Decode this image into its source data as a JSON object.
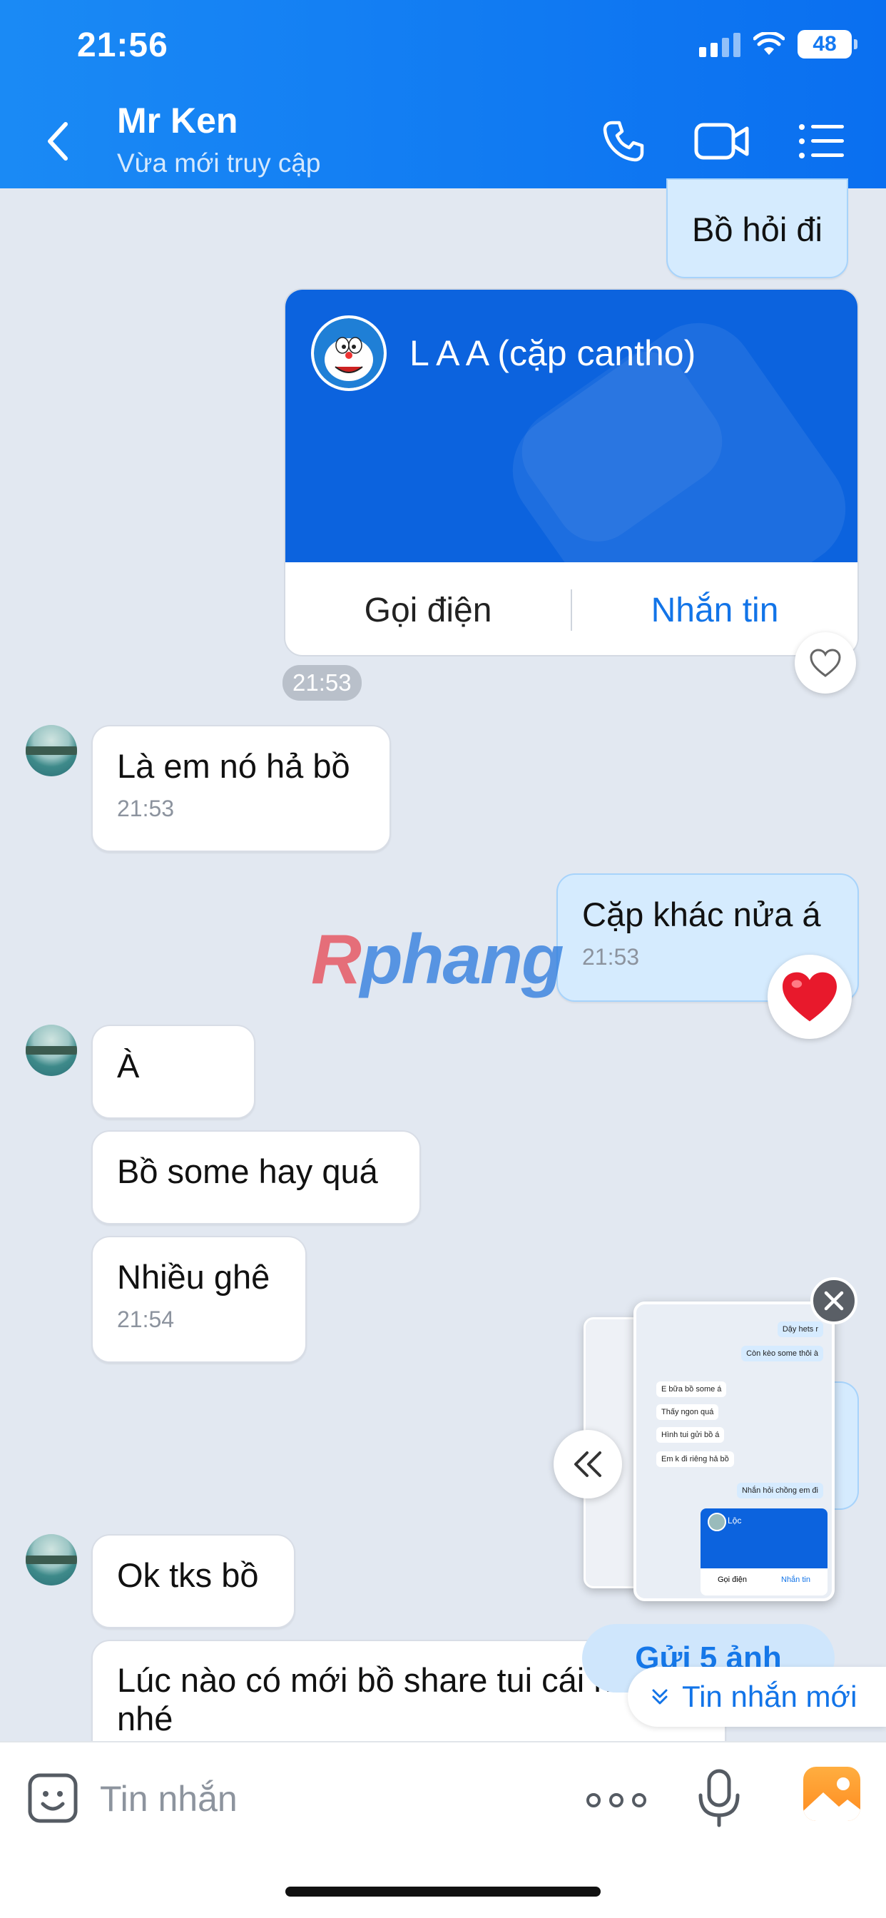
{
  "status_bar": {
    "time": "21:56",
    "battery": "48"
  },
  "header": {
    "contact_name": "Mr Ken",
    "contact_status": "Vừa mới truy cập"
  },
  "messages": [
    {
      "dir": "out",
      "text": "Bồ hỏi đi"
    },
    {
      "dir": "in",
      "text": "Là em nó hả bồ",
      "time": "21:53"
    },
    {
      "dir": "out",
      "text": "Cặp khác nửa á",
      "time": "21:53"
    },
    {
      "dir": "in",
      "text": "À"
    },
    {
      "dir": "in",
      "text": "Bồ some hay quá"
    },
    {
      "dir": "in",
      "text": "Nhiều ghê",
      "time": "21:54"
    },
    {
      "dir": "in",
      "text": "Ok tks bồ"
    },
    {
      "dir": "in",
      "text": "Lúc nào có mới bồ share tui cái nha bồ nhé"
    }
  ],
  "contact_card": {
    "name": "L A A (cặp cantho)",
    "call_label": "Gọi điện",
    "message_label": "Nhắn tin",
    "time": "21:53"
  },
  "watermark": {
    "part1": "R",
    "part2": "phang"
  },
  "preview": {
    "messages": [
      {
        "dir": "out",
        "text": "Dậy hets r"
      },
      {
        "dir": "out",
        "text": "Còn kèo some thôi à"
      },
      {
        "dir": "in",
        "text": "E bữa bồ some á"
      },
      {
        "dir": "in",
        "text": "Thấy ngon quá"
      },
      {
        "dir": "in",
        "text": "Hình tui gửi bồ á"
      },
      {
        "dir": "in",
        "text": "Em k đi riêng hả bồ"
      },
      {
        "dir": "out",
        "text": "Nhắn hỏi chồng em đi"
      }
    ],
    "card_name": "Lộc",
    "card_call": "Gọi điện",
    "card_message": "Nhắn tin"
  },
  "send_photos_label": "Gửi 5 ảnh",
  "new_messages_label": "Tin nhắn mới",
  "composer": {
    "placeholder": "Tin nhắn"
  },
  "colors": {
    "header": "#0a6ff0",
    "accent": "#1274e8",
    "out_bubble": "#d5ebfe",
    "in_bubble": "#ffffff",
    "heart": "#e8192c"
  },
  "icons": [
    "back-icon",
    "phone-icon",
    "video-icon",
    "menu-icon",
    "heart-outline-icon",
    "heart-filled-icon",
    "close-icon",
    "collapse-icon",
    "chevron-down-icon",
    "emoji-icon",
    "more-icon",
    "mic-icon",
    "photo-icon"
  ]
}
